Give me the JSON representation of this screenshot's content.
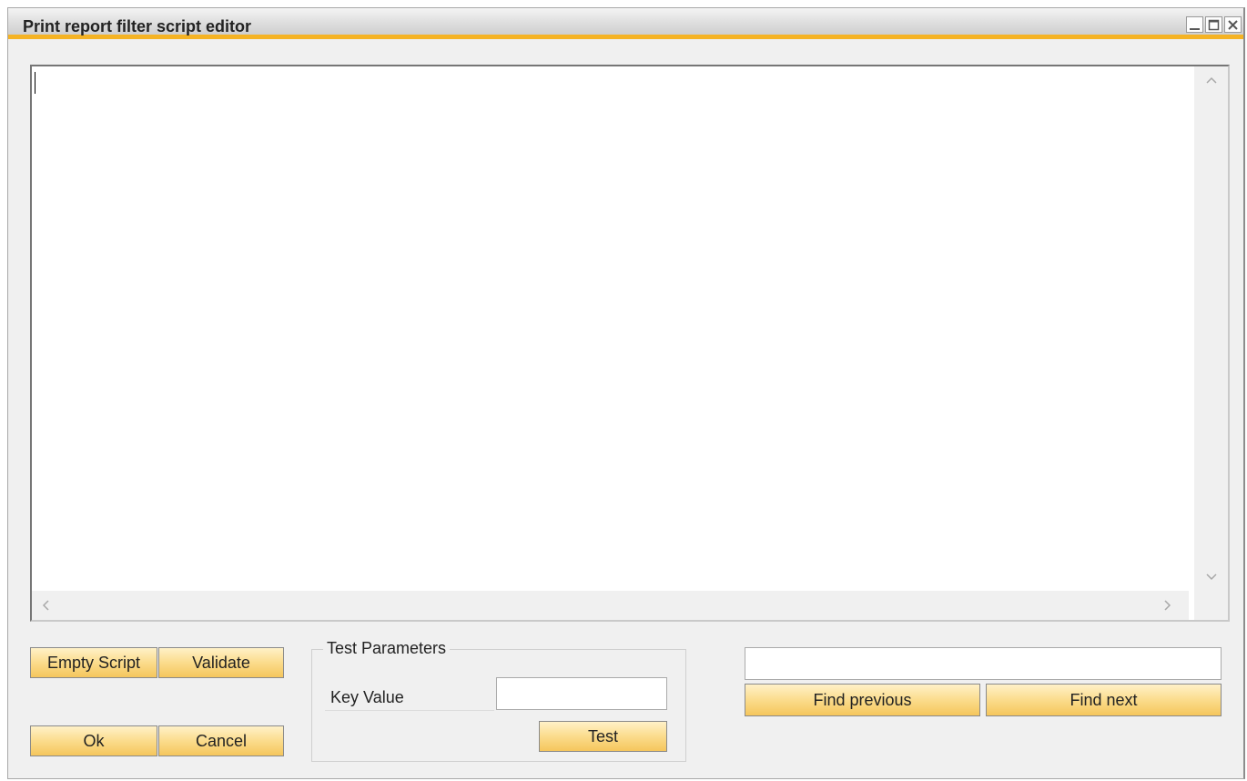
{
  "window": {
    "title": "Print report filter script editor",
    "controls": {
      "minimize_icon": "minimize-icon",
      "maximize_icon": "maximize-icon",
      "close_icon": "close-icon"
    }
  },
  "editor": {
    "value": "",
    "scroll_icons": {
      "up": "chevron-up-icon",
      "down": "chevron-down-icon",
      "left": "chevron-left-icon",
      "right": "chevron-right-icon"
    }
  },
  "buttons": {
    "empty_script": "Empty Script",
    "validate": "Validate",
    "ok": "Ok",
    "cancel": "Cancel",
    "test": "Test",
    "find_previous": "Find previous",
    "find_next": "Find next"
  },
  "test_parameters": {
    "title": "Test Parameters",
    "key_value_label": "Key Value",
    "key_value": ""
  },
  "find": {
    "value": ""
  },
  "colors": {
    "title_accent": "#f5b324",
    "button_gradient_top": "#fff1c8",
    "button_gradient_bottom": "#f5c65c",
    "window_background": "#f0f0f0"
  }
}
